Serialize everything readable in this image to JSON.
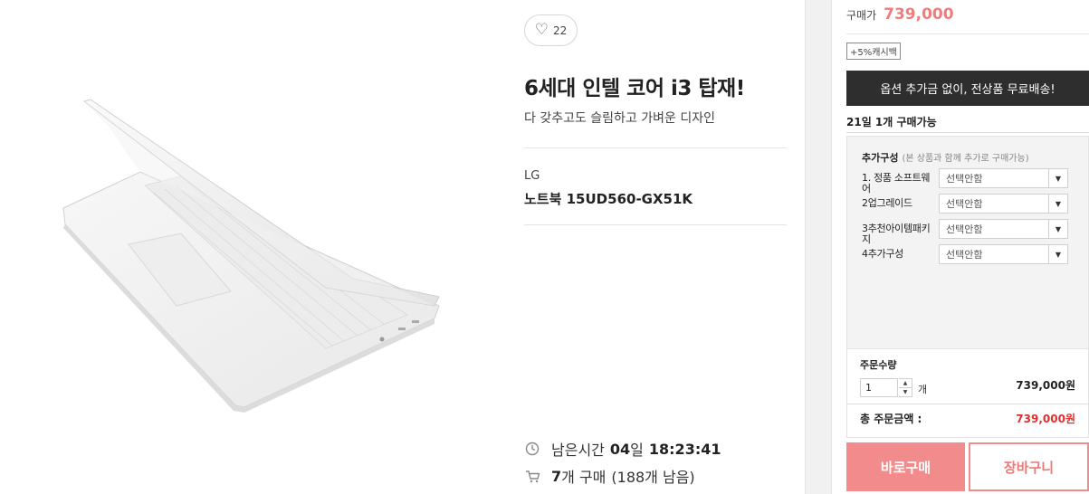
{
  "product": {
    "like_count": "22",
    "headline": "6세대 인텔 코어 i3 탑재!",
    "subtitle": "다 갖추고도 슬림하고 가벼운 디자인",
    "brand": "LG",
    "model": "노트북 15UD560-GX51K"
  },
  "timer": {
    "label": "남은시간",
    "days": "04",
    "days_unit": "일",
    "time": "18:23:41"
  },
  "sales": {
    "count": "7",
    "unit": "개 구매",
    "remaining": "(188개 남음)"
  },
  "purchase": {
    "price_label": "구매가",
    "price": "739,000",
    "cashback": "+5%캐시백",
    "banner": "옵션 추가금 없이, 전상품 무료배송!",
    "limit": "21일 1개 구매가능",
    "options_title": "추가구성",
    "options_note": "(본 상품과 함께 추가로 구매가능)",
    "options": [
      {
        "label": "1. 정품 소프트웨어",
        "value": "선택안함"
      },
      {
        "label": "2업그레이드",
        "value": "선택안함"
      },
      {
        "label": "3추천아이템패키지",
        "value": "선택안함"
      },
      {
        "label": "4추가구성",
        "value": "선택안함"
      }
    ],
    "qty_label": "주문수량",
    "qty": "1",
    "qty_unit": "개",
    "qty_subtotal": "739,000원",
    "total_label": "총 주문금액  :",
    "total": "739,000원",
    "buy_label": "바로구매",
    "cart_label": "장바구니"
  },
  "colors": {
    "accent": "#f28b8b",
    "price": "#f07c7c",
    "total": "#e03030",
    "banner": "#2e2e2e"
  },
  "icons": [
    "heart-icon",
    "clock-icon",
    "cart-icon",
    "dropdown-arrow-icon",
    "spinner-up-icon",
    "spinner-down-icon"
  ]
}
